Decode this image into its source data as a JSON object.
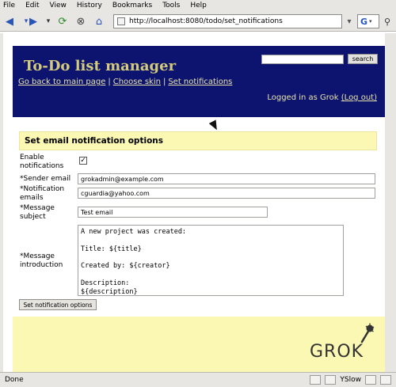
{
  "browser": {
    "menu": [
      "File",
      "Edit",
      "View",
      "History",
      "Bookmarks",
      "Tools",
      "Help"
    ],
    "url": "http://localhost:8080/todo/set_notifications",
    "search_engine_label": "G",
    "status": "Done",
    "yslow_label": "YSlow"
  },
  "header": {
    "title": "To-Do list manager",
    "search_button": "search",
    "nav": [
      "Go back to main page",
      "Choose skin",
      "Set notifications"
    ],
    "logged_in_prefix": "Logged in as Grok",
    "logout_label": "(Log out)"
  },
  "form": {
    "heading": "Set email notification options",
    "enable_label_1": "Enable",
    "enable_label_2": "notifications",
    "enable_checked_mark": "✓",
    "sender_label": "*Sender email",
    "sender_value": "grokadmin@example.com",
    "notification_label_1": "*Notification",
    "notification_label_2": "emails",
    "notification_value": "cguardia@yahoo.com",
    "subject_label_1": "*Message",
    "subject_label_2": "subject",
    "subject_value": "Test email",
    "intro_label_1": "*Message",
    "intro_label_2": "introduction",
    "intro_value": "A new project was created:\n\nTitle: ${title}\n\nCreated by: ${creator}\n\nDescription:\n${description}",
    "submit_label": "Set notification options"
  },
  "footer": {
    "logo_text": "GROK"
  },
  "colors": {
    "header_bg": "#0d1470",
    "title_color": "#d4cb7a",
    "link_color": "#e8e3a8",
    "panel_bg": "#fbf8b4"
  }
}
